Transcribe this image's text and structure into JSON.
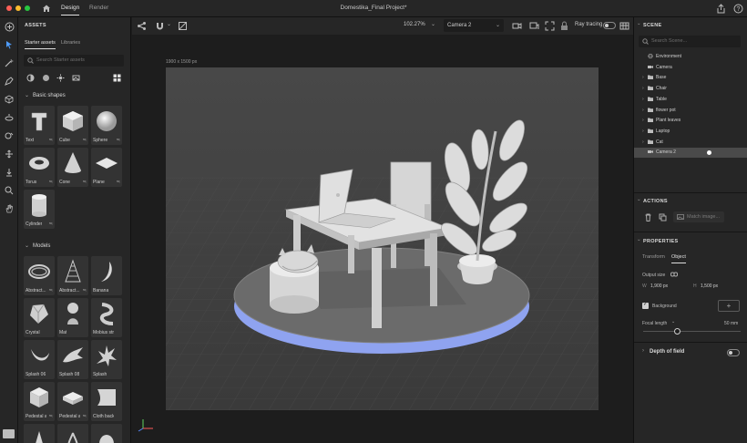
{
  "window": {
    "title": "Domestika_Final Project*",
    "tabs": [
      "Design",
      "Render"
    ],
    "active_tab": "Design"
  },
  "assets": {
    "heading": "ASSETS",
    "subtabs": [
      "Starter assets",
      "Libraries"
    ],
    "search_placeholder": "Search Starter assets",
    "sections": {
      "basic_shapes": "Basic shapes",
      "models": "Models"
    },
    "basic_shapes": [
      "Text",
      "Cube",
      "Sphere",
      "Torus",
      "Cone",
      "Plane",
      "Cylinder"
    ],
    "models": [
      "Abstract...",
      "Abstract...",
      "Banana",
      "Crystal",
      "Mat",
      "Mobius strip",
      "Splash 06",
      "Splash 08",
      "Splash",
      "Pedestal a...",
      "Pedestal a...",
      "Cloth back..."
    ]
  },
  "viewport": {
    "zoom": "102.27%",
    "camera": "Camera 2",
    "ray_tracing_label": "Ray tracing",
    "canvas_size": "1900 x 1500 px"
  },
  "scene": {
    "heading": "SCENE",
    "search_placeholder": "Search Scene...",
    "items": [
      {
        "label": "Environment",
        "type": "environment",
        "expandable": false
      },
      {
        "label": "Camera",
        "type": "camera",
        "expandable": false
      },
      {
        "label": "Base",
        "type": "folder",
        "expandable": true
      },
      {
        "label": "Chair",
        "type": "folder",
        "expandable": true
      },
      {
        "label": "Table",
        "type": "folder",
        "expandable": true
      },
      {
        "label": "flower pot",
        "type": "folder",
        "expandable": true
      },
      {
        "label": "Plant leaves",
        "type": "folder",
        "expandable": true
      },
      {
        "label": "Laptop",
        "type": "folder",
        "expandable": true
      },
      {
        "label": "Cat",
        "type": "folder",
        "expandable": true
      },
      {
        "label": "Camera 2",
        "type": "camera",
        "expandable": false,
        "selected": true
      }
    ]
  },
  "actions": {
    "heading": "ACTIONS",
    "match_image": "Match image..."
  },
  "properties": {
    "heading": "PROPERTIES",
    "tabs": [
      "Transform",
      "Object"
    ],
    "active_tab": "Object",
    "output_size_label": "Output size",
    "width_label": "W",
    "width_value": "1,900 px",
    "height_label": "H",
    "height_value": "1,500 px",
    "background_label": "Background",
    "background_checked": true,
    "focal_length_label": "Focal length",
    "focal_length_value": "50 mm",
    "focal_length_fraction": 0.35,
    "depth_of_field_label": "Depth of field"
  },
  "colors": {
    "accent_ring": "#8fa3f0",
    "panel": "#262626",
    "viewport": "#1d1d1d",
    "canvas": "#3f3f3f"
  }
}
